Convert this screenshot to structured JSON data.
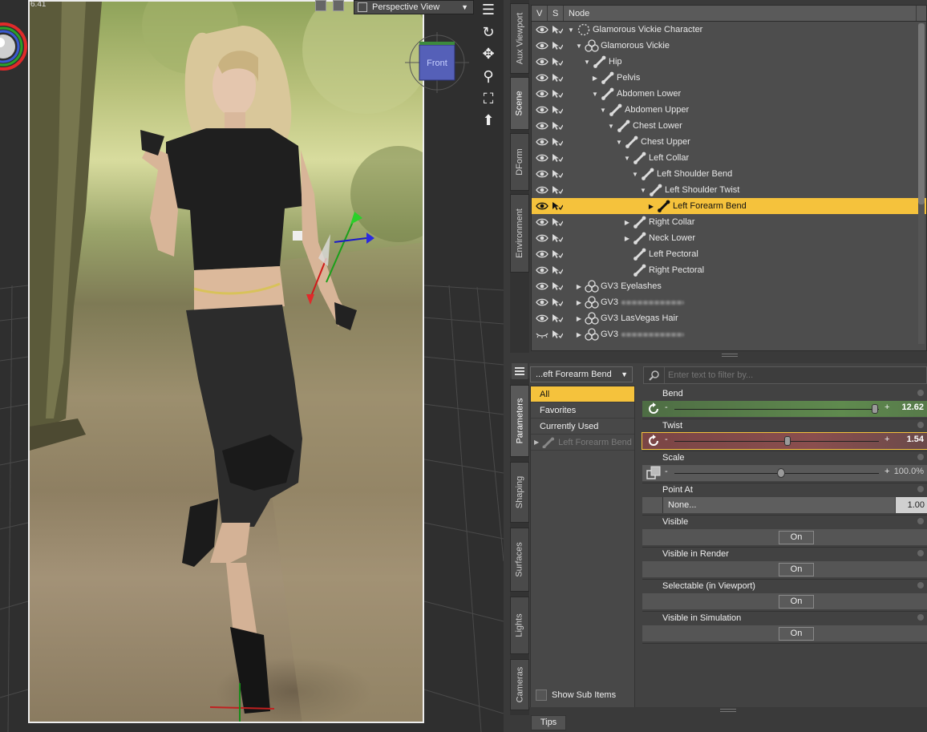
{
  "viewport": {
    "fps": "6.41",
    "view_select": "Perspective View",
    "cube_label": "Front"
  },
  "tabs_top": {
    "aux_viewport": "Aux Viewport",
    "scene": "Scene",
    "dform": "DForm",
    "environment": "Environment"
  },
  "tabs_bottom": {
    "parameters": "Parameters",
    "shaping": "Shaping",
    "surfaces": "Surfaces",
    "lights": "Lights",
    "cameras": "Cameras"
  },
  "scene": {
    "col_v": "V",
    "col_s": "S",
    "col_node": "Node",
    "rows": [
      {
        "label": "Glamorous Vickie Character"
      },
      {
        "label": "Glamorous Vickie"
      },
      {
        "label": "Hip"
      },
      {
        "label": "Pelvis"
      },
      {
        "label": "Abdomen Lower"
      },
      {
        "label": "Abdomen Upper"
      },
      {
        "label": "Chest Lower"
      },
      {
        "label": "Chest Upper"
      },
      {
        "label": "Left Collar"
      },
      {
        "label": "Left Shoulder Bend"
      },
      {
        "label": "Left Shoulder Twist"
      },
      {
        "label": "Left Forearm Bend"
      },
      {
        "label": "Right Collar"
      },
      {
        "label": "Neck Lower"
      },
      {
        "label": "Left Pectoral"
      },
      {
        "label": "Right Pectoral"
      },
      {
        "label": "GV3 Eyelashes"
      },
      {
        "label": "GV3"
      },
      {
        "label": "GV3 LasVegas Hair"
      },
      {
        "label": "GV3"
      }
    ]
  },
  "params": {
    "selection": "...eft Forearm Bend",
    "filter_placeholder": "Enter text to filter by...",
    "groups": [
      "All",
      "Favorites",
      "Currently Used"
    ],
    "group_node": "Left Forearm Bend",
    "show_sub_items": "Show Sub Items",
    "bend": {
      "name": "Bend",
      "value": "12.62",
      "minus": "-",
      "plus": "+"
    },
    "twist": {
      "name": "Twist",
      "value": "1.54",
      "minus": "-",
      "plus": "+"
    },
    "scale": {
      "name": "Scale",
      "value": "100.0%",
      "minus": "-",
      "plus": "+"
    },
    "point_at": {
      "name": "Point At",
      "target": "None...",
      "value": "1.00"
    },
    "visible": {
      "name": "Visible",
      "state": "On"
    },
    "visible_render": {
      "name": "Visible in Render",
      "state": "On"
    },
    "selectable": {
      "name": "Selectable (in Viewport)",
      "state": "On"
    },
    "visible_sim": {
      "name": "Visible in Simulation",
      "state": "On"
    }
  },
  "footer": {
    "tips": "Tips"
  },
  "colors": {
    "accent": "#f5c23c",
    "bend_track": "#5f8a4e",
    "twist_track": "#8a4e4e"
  }
}
